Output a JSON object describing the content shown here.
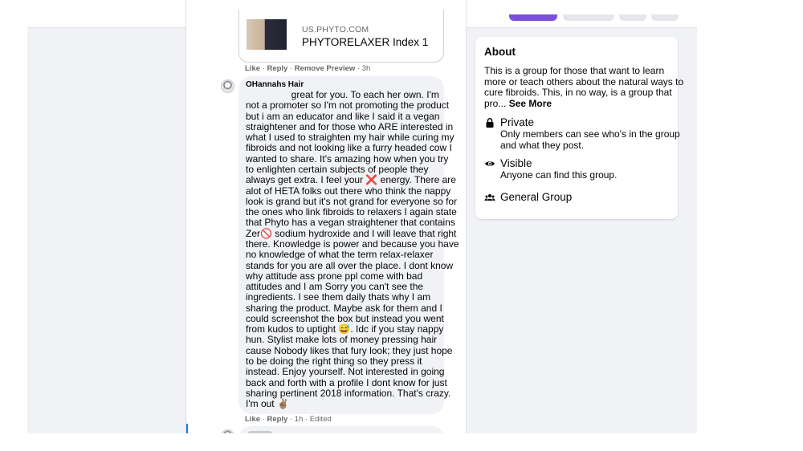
{
  "link_preview": {
    "domain": "US.PHYTO.COM",
    "title": "PHYTORELAXER Index 1"
  },
  "link_actions": {
    "like": "Like",
    "reply": "Reply",
    "remove_preview": "Remove Preview",
    "time": "3h"
  },
  "comment": {
    "author": "OHannahs Hair",
    "text": "                 great for you. To each her own. I'm\nnot a promoter so I'm not promoting the product\nbut i am an educator and like I said it a vegan\nstraightener and for those who ARE interested in\nwhat I used to straighten my hair while curing my\nfibroids and not looking like a furry headed cow I\nwanted to share. It's amazing how when you try\nto enlighten certain subjects of people they\nalways get extra. I feel your ❌ energy. There are\nalot of HETA folks out there who think the nappy\nlook is grand but it's not grand for everyone so for\nthe ones who link fibroids to relaxers I again state\nthat Phyto has a vegan straightener that contains\nZer🚫 sodium hydroxide and I will leave that right\nthere. Knowledge is power and because you have\nno knowledge of what the term relax-relaxer\nstands for you are all over the place. I dont know\nwhy attitude ass prone ppl come with bad\nattitudes and I am Sorry you can't see the\ningredients. I see them daily thats why I am\nsharing the product. Maybe ask for them and I\ncould screenshot the box but instead you went\nfrom kudos to uptight 😅. Idc if you stay nappy\nhun. Stylist make lots of money pressing hair\ncause Nobody likes that fury look; they just hope\nto be doing the right thing so they press it\ninstead. Enjoy yourself. Not interested in going\nback and forth with a profile I dont know for just\nsharing pertinent 2018 information. That's crazy.\nI'm out ✌🏽",
    "like": "Like",
    "reply": "Reply",
    "time": "1h",
    "edited": "Edited"
  },
  "about": {
    "title": "About",
    "description": "This is a group for those that want to learn\nmore or teach others about the natural ways to\ncure fibroids. This, in no way, is a group that\npro... ",
    "see_more": "See More",
    "privacy_title": "Private",
    "privacy_desc": "Only members can see who's in the group\nand what they post.",
    "visibility_title": "Visible",
    "visibility_desc": "Anyone can find this group.",
    "type_title": "General Group"
  },
  "colors": {
    "accent_tab": "#7b4fd9",
    "link_blue": "#1877f2",
    "bubble_bg": "#f0f2f5"
  },
  "icons": [
    "lock-icon",
    "eye-icon",
    "group-icon"
  ]
}
